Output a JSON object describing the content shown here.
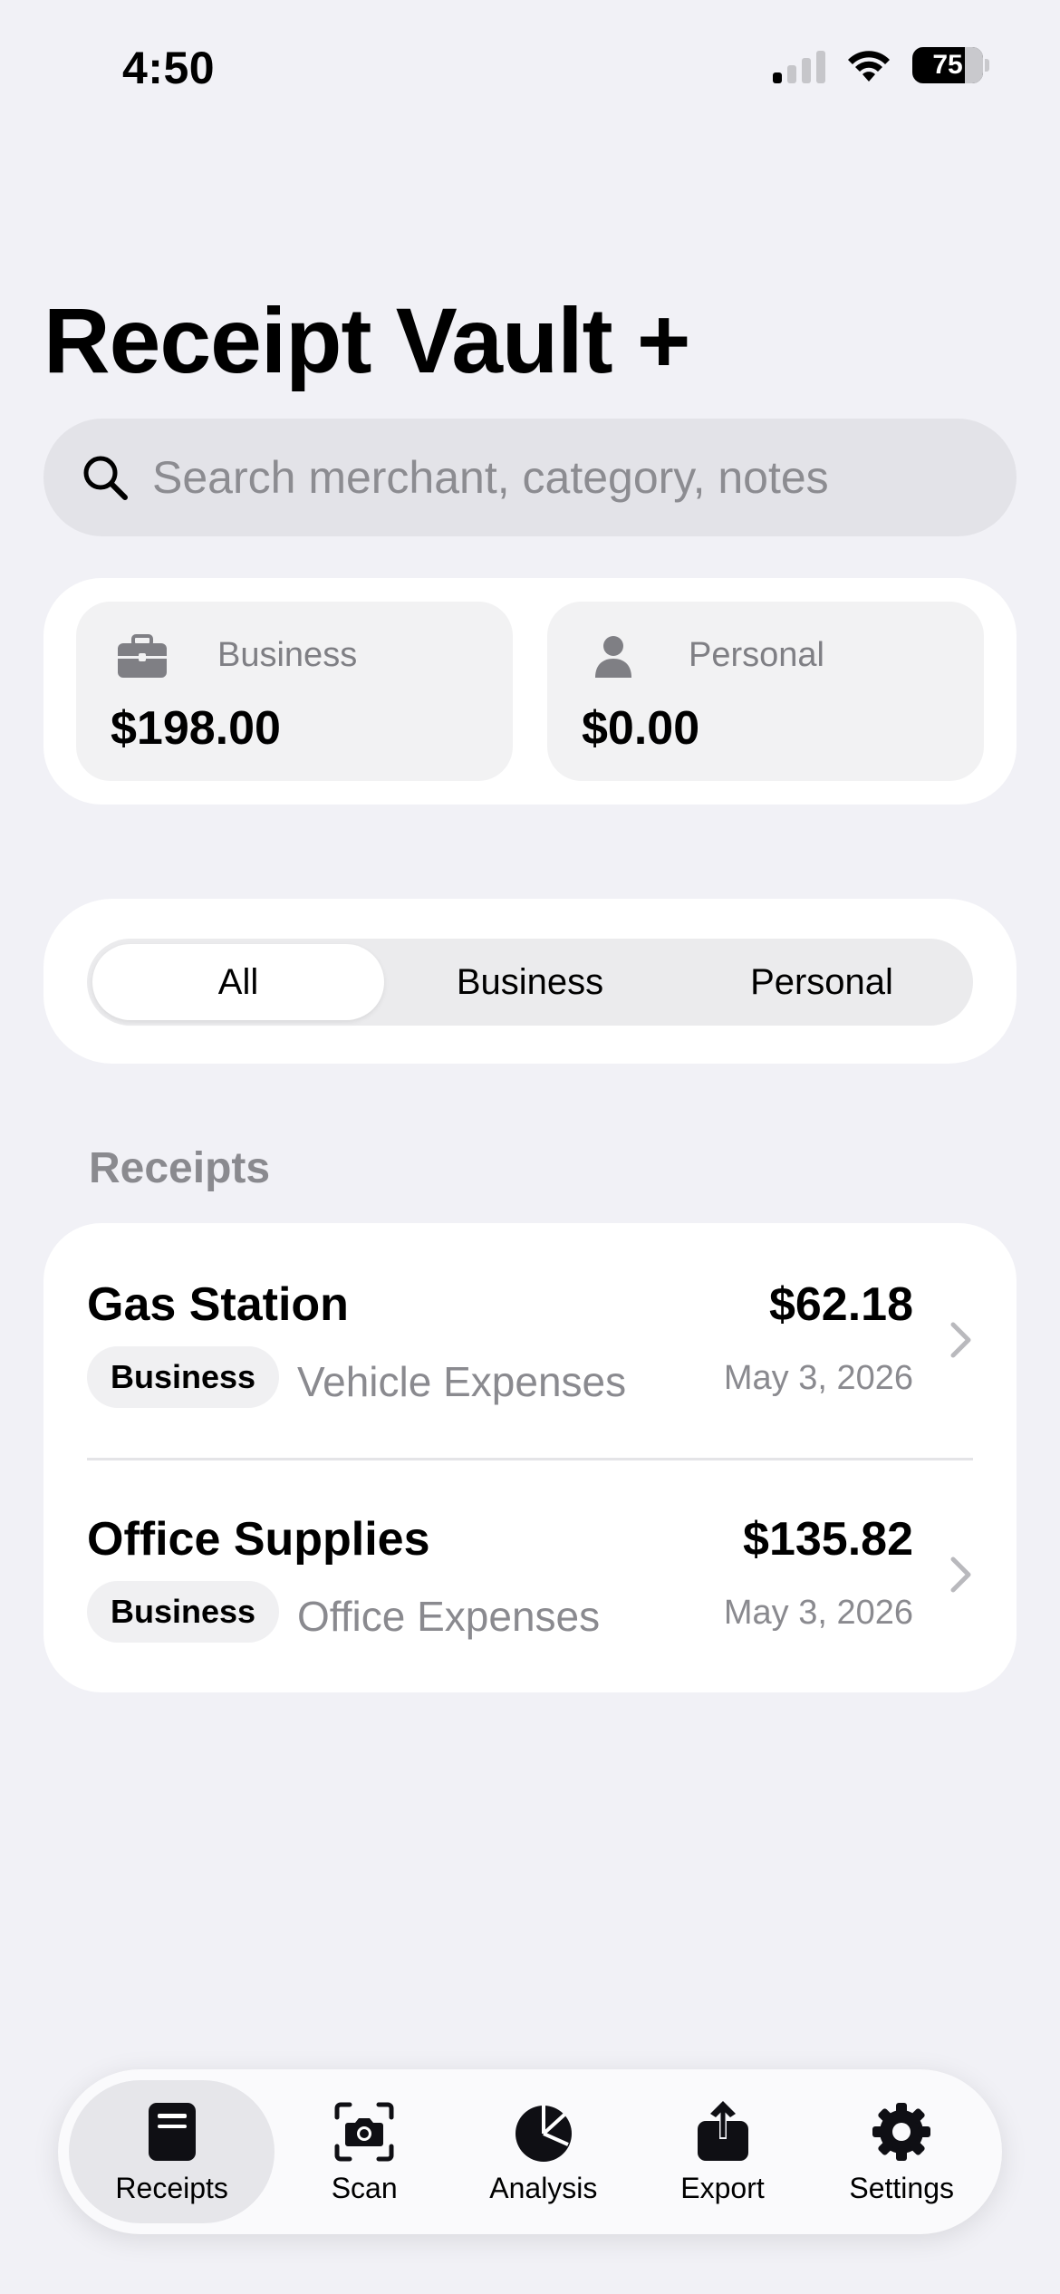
{
  "status_bar": {
    "time": "4:50",
    "battery": "75"
  },
  "header": {
    "title": "Receipt Vault +"
  },
  "search": {
    "placeholder": "Search merchant, category, notes",
    "value": ""
  },
  "summary": {
    "business": {
      "label": "Business",
      "amount": "$198.00",
      "icon": "briefcase-icon"
    },
    "personal": {
      "label": "Personal",
      "amount": "$0.00",
      "icon": "person-icon"
    }
  },
  "filter": {
    "options": [
      "All",
      "Business",
      "Personal"
    ],
    "selected": "All"
  },
  "section": {
    "title": "Receipts"
  },
  "receipts": [
    {
      "merchant": "Gas Station",
      "amount": "$62.18",
      "tag": "Business",
      "category": "Vehicle Expenses",
      "date": "May 3, 2026"
    },
    {
      "merchant": "Office Supplies",
      "amount": "$135.82",
      "tag": "Business",
      "category": "Office Expenses",
      "date": "May 3, 2026"
    }
  ],
  "tabbar": {
    "tabs": [
      {
        "label": "Receipts",
        "icon": "receipts-icon",
        "active": true
      },
      {
        "label": "Scan",
        "icon": "camera-icon",
        "active": false
      },
      {
        "label": "Analysis",
        "icon": "pie-chart-icon",
        "active": false
      },
      {
        "label": "Export",
        "icon": "share-icon",
        "active": false
      },
      {
        "label": "Settings",
        "icon": "gear-icon",
        "active": false
      }
    ]
  },
  "colors": {
    "background": "#f1f1f6",
    "card": "#ffffff",
    "secondary_text": "#8a8a8f",
    "search_fill": "#e3e3e8"
  }
}
